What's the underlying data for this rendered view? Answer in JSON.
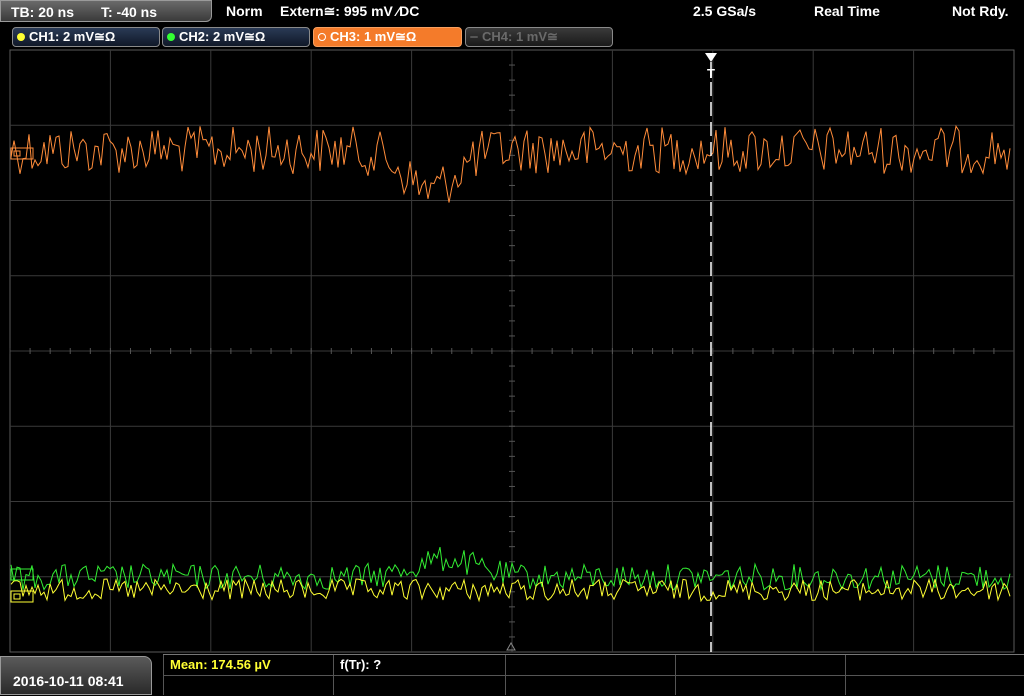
{
  "topbar": {
    "timebase": "TB: 20 ns",
    "trigger_time": "T: -40 ns",
    "mode": "Norm",
    "trigger_source": "Extern≅: 995 mV ⁄DC",
    "sample_rate": "2.5 GSa/s",
    "acq_mode": "Real Time",
    "status": "Not Rdy."
  },
  "channels": [
    {
      "label": "CH1: 2 mV≅Ω",
      "color": "#ffff33"
    },
    {
      "label": "CH2: 2 mV≅Ω",
      "color": "#33ff33"
    },
    {
      "label": "CH3: 1 mV≅Ω",
      "color": "#ff8c3a"
    },
    {
      "label": "CH4: 1 mV≅",
      "color": "#7a7a7a"
    }
  ],
  "trigger_marker": "T",
  "footer": {
    "datetime": "2016-10-11 08:41",
    "meas1": "Mean: 174.56 µV",
    "meas2": "f(Tr): ?"
  }
}
